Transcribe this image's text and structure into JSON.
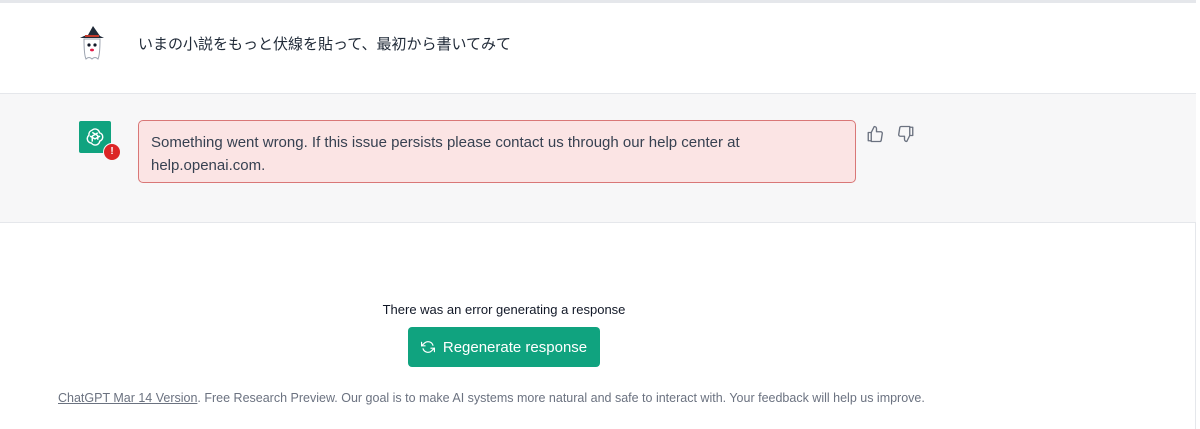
{
  "conversation": {
    "user_message": "いまの小説をもっと伏線を貼って、最初から書いてみて",
    "user_avatar_icon": "witch-ghost-avatar-icon",
    "assistant_avatar_icon": "openai-logo-icon",
    "error_badge": "!",
    "error_message": "Something went wrong. If this issue persists please contact us through our help center at help.openai.com.",
    "feedback": {
      "thumbs_up_icon": "thumbs-up-icon",
      "thumbs_down_icon": "thumbs-down-icon"
    }
  },
  "regenerate": {
    "error_text": "There was an error generating a response",
    "button_label": "Regenerate response",
    "button_icon": "refresh-icon"
  },
  "footer": {
    "link_text": "ChatGPT Mar 14 Version",
    "text": ". Free Research Preview. Our goal is to make AI systems more natural and safe to interact with. Your feedback will help us improve."
  },
  "colors": {
    "accent": "#10a37f",
    "error_bg": "#fbe4e4",
    "error_border": "#d97777",
    "error_dot": "#dc2626",
    "assistant_bg": "#f7f7f8"
  }
}
